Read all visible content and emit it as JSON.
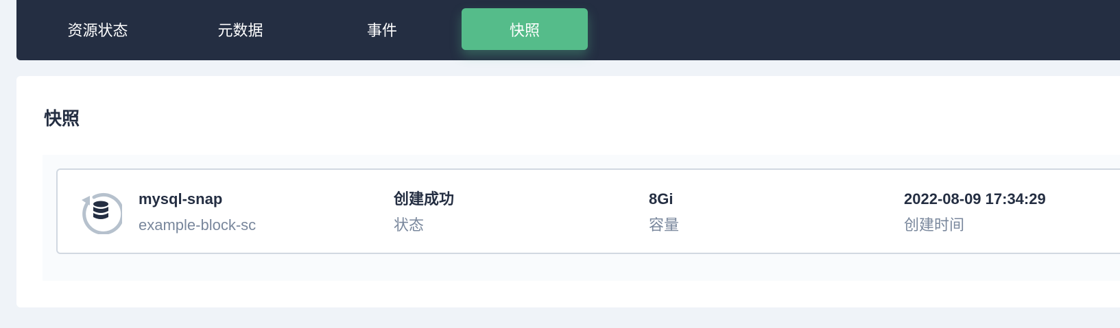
{
  "tabs": [
    {
      "label": "资源状态",
      "active": false
    },
    {
      "label": "元数据",
      "active": false
    },
    {
      "label": "事件",
      "active": false
    },
    {
      "label": "快照",
      "active": true
    }
  ],
  "panel": {
    "title": "快照"
  },
  "snapshot": {
    "icon": "snapshot-database-icon",
    "name": "mysql-snap",
    "storage_class": "example-block-sc",
    "status_value": "创建成功",
    "status_label": "状态",
    "capacity_value": "8Gi",
    "capacity_label": "容量",
    "created_value": "2022-08-09 17:34:29",
    "created_label": "创建时间"
  },
  "colors": {
    "header_bg": "#242e42",
    "active_tab": "#55bc8a",
    "page_bg": "#eff3f8",
    "text_primary": "#242e42",
    "text_secondary": "#79879c"
  }
}
